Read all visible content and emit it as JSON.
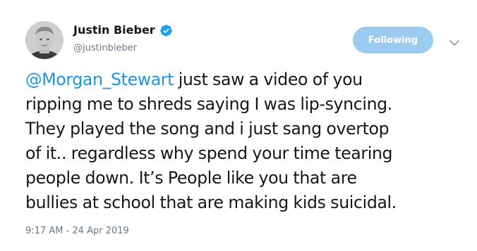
{
  "user": {
    "name": "Justin Bieber",
    "handle": "@justinbieber",
    "verified": true
  },
  "follow_button": {
    "label": "Following"
  },
  "menu": {
    "icon": "chevron-down-icon"
  },
  "tweet": {
    "mention": "@Morgan_Stewart",
    "line1_rest": " just saw a video of you",
    "line2": "ripping me to shreds saying I was lip-syncing.",
    "line3": "They played the song and i just sang overtop",
    "line4": "of it.. regardless why spend your time tearing",
    "line5": "people down. It’s People like you that are",
    "line6": "bullies at school that are making kids suicidal."
  },
  "timestamp": "9:17 AM - 24 Apr 2019",
  "colors": {
    "link": "#1b95e0",
    "follow_button_bg": "#9ccbf0",
    "verified_badge": "#1da1f2",
    "secondary_text": "#657786",
    "primary_text": "#14171a"
  }
}
